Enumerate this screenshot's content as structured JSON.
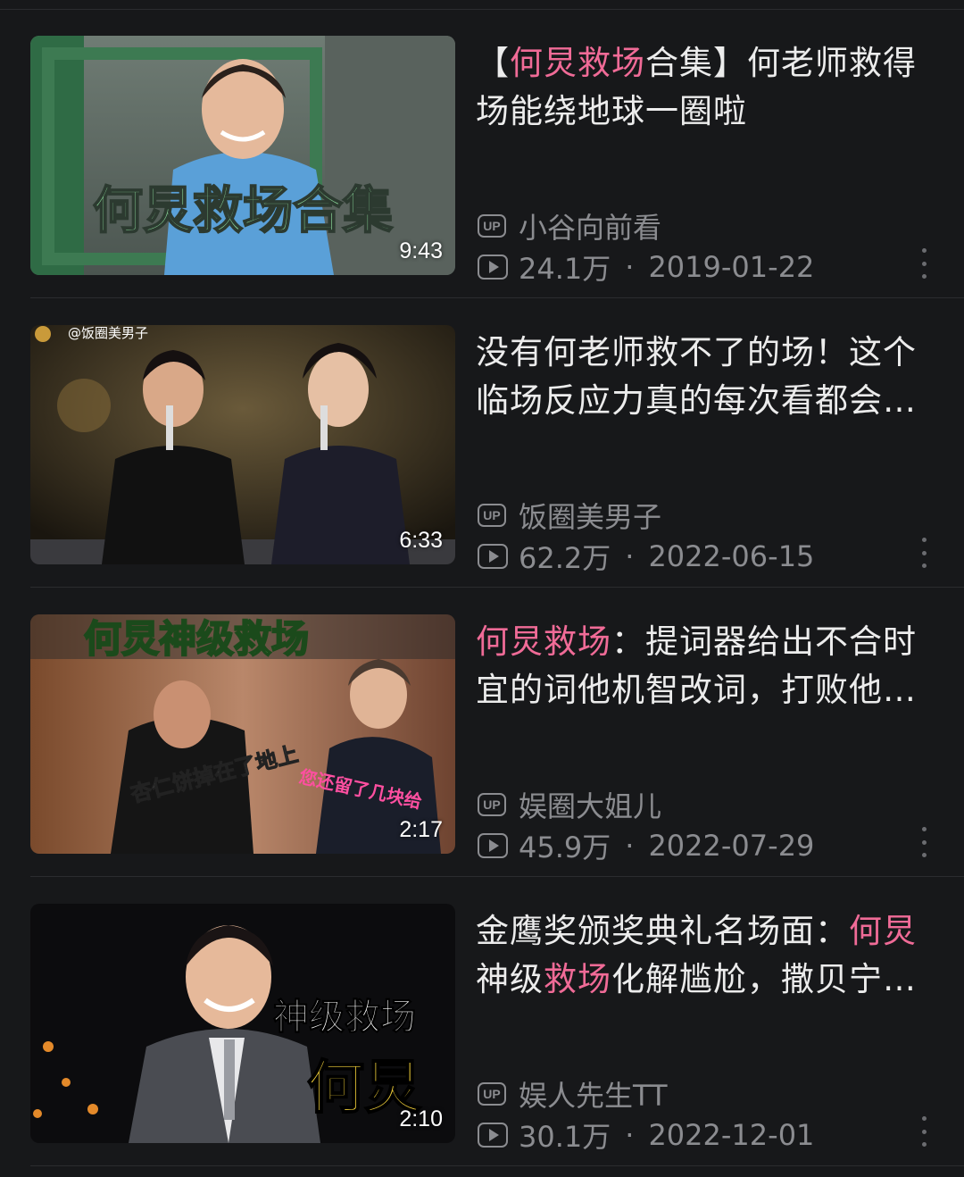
{
  "videos": [
    {
      "title_parts": [
        {
          "text": "【",
          "hl": false
        },
        {
          "text": "何炅救场",
          "hl": true
        },
        {
          "text": "合集】何老师救得场能绕地球一圈啦",
          "hl": false
        }
      ],
      "uploader": "小谷向前看",
      "views": "24.1万",
      "date": "2019-01-22",
      "duration": "9:43",
      "thumb_caption": "何炅救场合集"
    },
    {
      "title_parts": [
        {
          "text": "没有何老师救不了的场！这个临场反应力真的每次看都会惊艳",
          "hl": false
        }
      ],
      "uploader": "饭圈美男子",
      "views": "62.2万",
      "date": "2022-06-15",
      "duration": "6:33",
      "thumb_caption": "@饭圈美男子"
    },
    {
      "title_parts": [
        {
          "text": "何炅救场",
          "hl": true
        },
        {
          "text": "：提词器给出不合时宜的词他机智改词，打败他的人出现了",
          "hl": false
        }
      ],
      "uploader": "娱圈大姐儿",
      "views": "45.9万",
      "date": "2022-07-29",
      "duration": "2:17",
      "thumb_caption": "何炅神级救场",
      "thumb_caption2": "杏仁饼掉在了地上",
      "thumb_caption3": "您还留了几块给"
    },
    {
      "title_parts": [
        {
          "text": "金鹰奖颁奖典礼名场面：",
          "hl": false
        },
        {
          "text": "何炅",
          "hl": true
        },
        {
          "text": "神级",
          "hl": false
        },
        {
          "text": "救场",
          "hl": true
        },
        {
          "text": "化解尴尬，撒贝宁表情亮了",
          "hl": false
        }
      ],
      "uploader": "娱人先生TT",
      "views": "30.1万",
      "date": "2022-12-01",
      "duration": "2:10",
      "thumb_caption": "神级救场",
      "thumb_caption2": "何炅"
    }
  ],
  "labels": {
    "up_badge": "UP",
    "separator": "·"
  },
  "colors": {
    "highlight": "#f06b97",
    "background": "#17181a",
    "meta": "#8b8c90"
  },
  "icons": {
    "up": "up-badge-icon",
    "play": "play-count-icon",
    "more": "more-vertical-icon"
  }
}
